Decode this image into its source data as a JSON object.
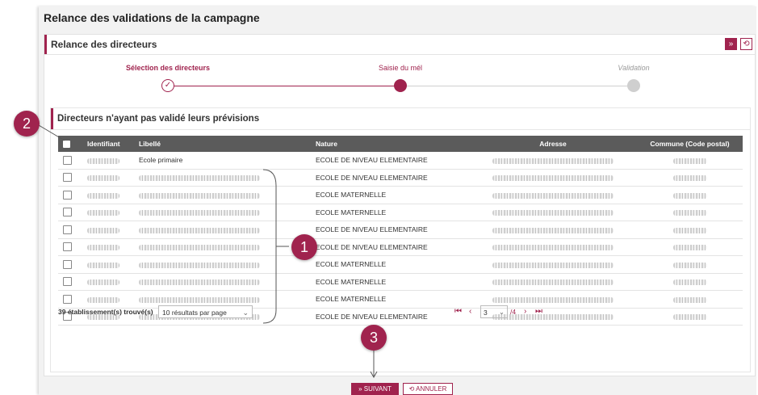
{
  "page_title": "Relance des validations de la campagne",
  "panel": {
    "title": "Relance des directeurs",
    "expand_icon": "»",
    "reset_icon": "⟲"
  },
  "stepper": {
    "steps": [
      {
        "label": "Sélection des directeurs",
        "state": "done",
        "icon": "✓"
      },
      {
        "label": "Saisie du mél",
        "state": "current"
      },
      {
        "label": "Validation",
        "state": "todo"
      }
    ]
  },
  "section": {
    "title": "Directeurs n'ayant pas validé leurs prévisions"
  },
  "table": {
    "columns": [
      "Identifiant",
      "Libellé",
      "Nature",
      "Adresse",
      "Commune (Code postal)"
    ],
    "rows": [
      {
        "libelle": "Ecole primaire",
        "nature": "ECOLE DE NIVEAU ELEMENTAIRE"
      },
      {
        "libelle": "",
        "nature": "ECOLE DE NIVEAU ELEMENTAIRE"
      },
      {
        "libelle": "",
        "nature": "ECOLE MATERNELLE"
      },
      {
        "libelle": "",
        "nature": "ECOLE MATERNELLE"
      },
      {
        "libelle": "",
        "nature": "ECOLE DE NIVEAU ELEMENTAIRE"
      },
      {
        "libelle": "",
        "nature": "ECOLE DE NIVEAU ELEMENTAIRE"
      },
      {
        "libelle": "",
        "nature": "ECOLE MATERNELLE"
      },
      {
        "libelle": "",
        "nature": "ECOLE MATERNELLE"
      },
      {
        "libelle": "",
        "nature": "ECOLE MATERNELLE"
      },
      {
        "libelle": "",
        "nature": "ECOLE DE NIVEAU ELEMENTAIRE"
      }
    ]
  },
  "footer": {
    "count_text": "39 établissement(s) trouvé(s)",
    "per_page": "10 résultats par page",
    "current_page": "3",
    "total_pages": "/4"
  },
  "buttons": {
    "next": "» SUIVANT",
    "cancel": "⟲ ANNULER"
  },
  "callouts": [
    "1",
    "2",
    "3"
  ],
  "colors": {
    "accent": "#a0234e",
    "header": "#5b5b5b"
  }
}
